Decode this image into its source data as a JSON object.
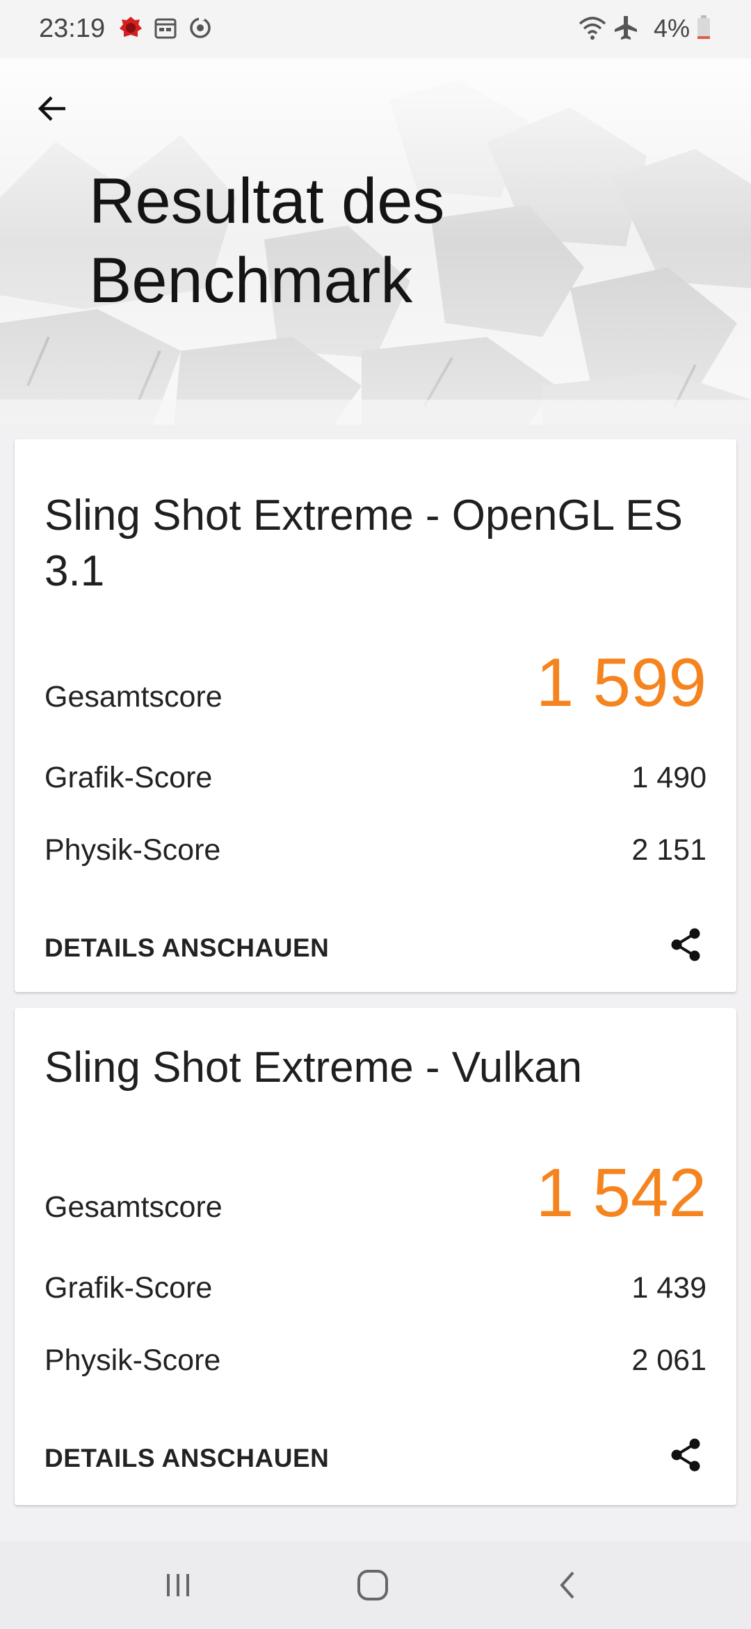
{
  "status_bar": {
    "time": "23:19",
    "battery_percent": "4%",
    "icons": [
      "app-notification-icon",
      "calendar-icon",
      "sync-icon",
      "wifi-icon",
      "airplane-icon",
      "battery-icon"
    ]
  },
  "header": {
    "title": "Resultat des Benchmark"
  },
  "results": [
    {
      "title": "Sling Shot Extreme - OpenGL ES 3.1",
      "total_label": "Gesamtscore",
      "total_value": "1 599",
      "graphics_label": "Grafik-Score",
      "graphics_value": "1 490",
      "physics_label": "Physik-Score",
      "physics_value": "2 151",
      "details_label": "DETAILS ANSCHAUEN"
    },
    {
      "title": "Sling Shot Extreme - Vulkan",
      "total_label": "Gesamtscore",
      "total_value": "1 542",
      "graphics_label": "Grafik-Score",
      "graphics_value": "1 439",
      "physics_label": "Physik-Score",
      "physics_value": "2 061",
      "details_label": "DETAILS ANSCHAUEN"
    }
  ],
  "colors": {
    "accent": "#f5841f",
    "text": "#1c1c1c",
    "background": "#f1f1f3"
  }
}
